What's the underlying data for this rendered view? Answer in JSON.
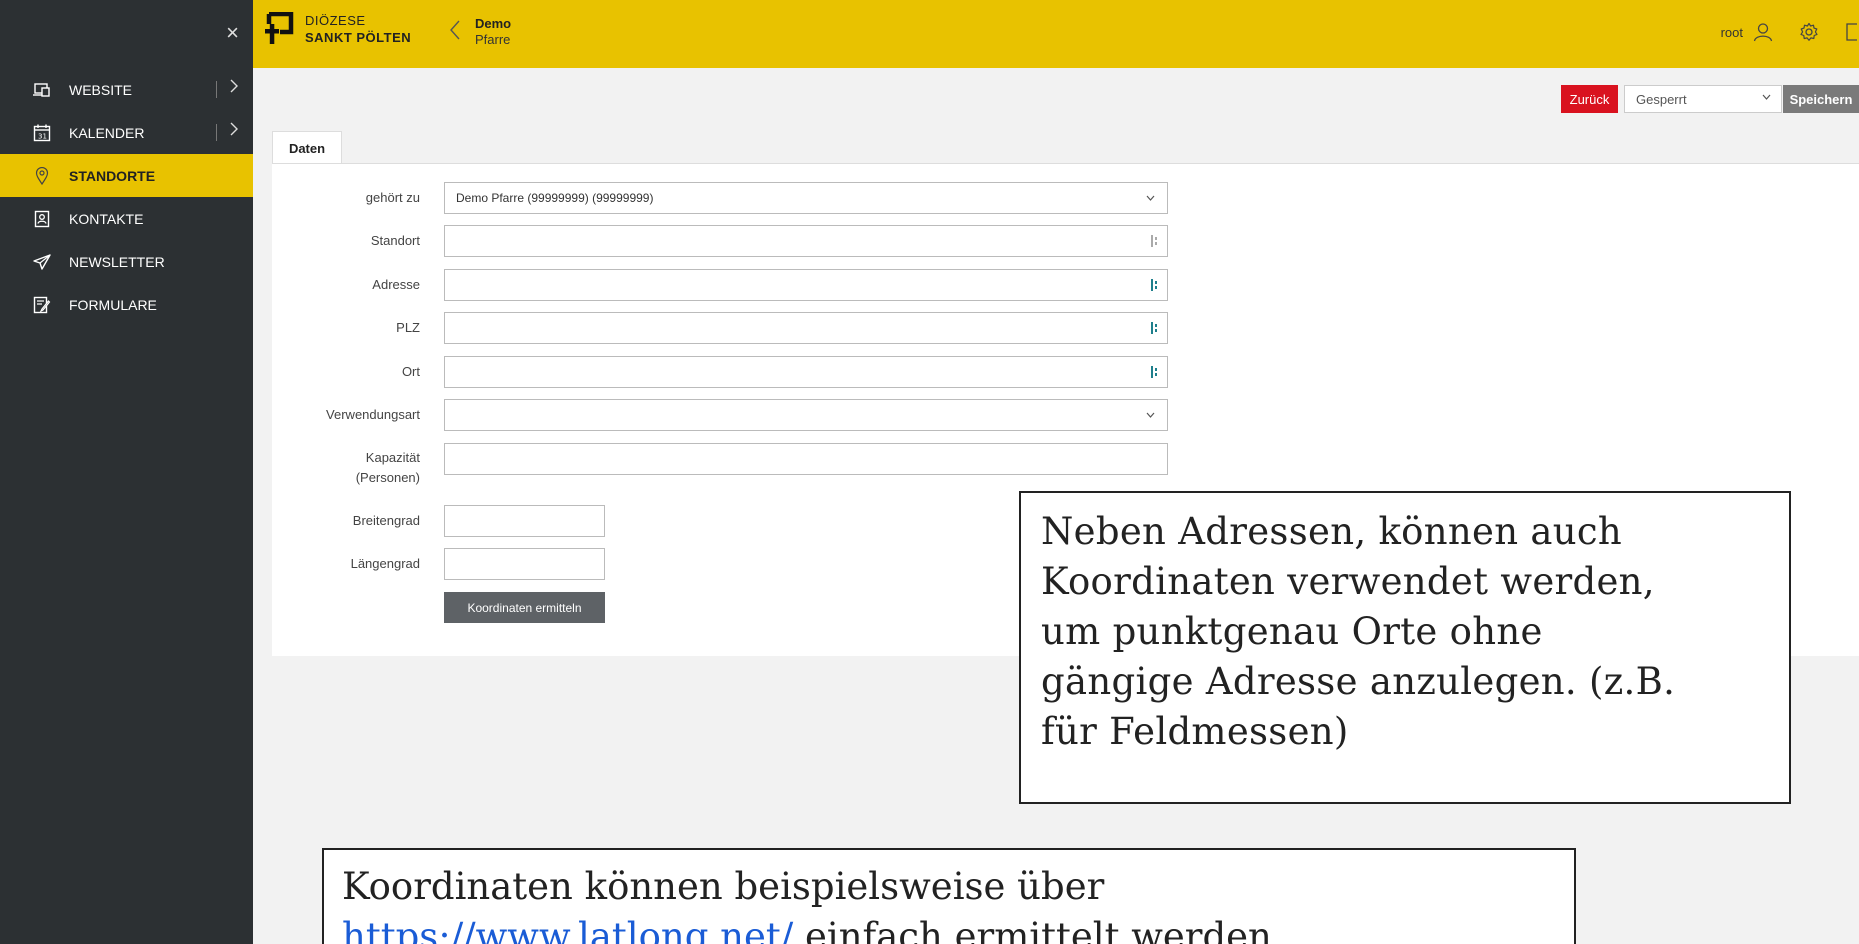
{
  "sidebar": {
    "close_glyph": "×",
    "items": [
      {
        "label": "WEBSITE",
        "icon": "laptop-icon",
        "has_submenu": true
      },
      {
        "label": "KALENDER",
        "icon": "calendar-icon",
        "has_submenu": true
      },
      {
        "label": "STANDORTE",
        "icon": "location-pin-icon",
        "active": true
      },
      {
        "label": "KONTAKTE",
        "icon": "contact-card-icon"
      },
      {
        "label": "NEWSLETTER",
        "icon": "paper-plane-icon"
      },
      {
        "label": "FORMULARE",
        "icon": "form-edit-icon"
      }
    ]
  },
  "header": {
    "logo_line1": "DIÖZESE",
    "logo_line2": "SANKT PÖLTEN",
    "breadcrumb_title": "Demo",
    "breadcrumb_sub": "Pfarre",
    "username": "root"
  },
  "actions": {
    "back_label": "Zurück",
    "status_value": "Gesperrt",
    "save_label": "Speichern"
  },
  "tabs": [
    {
      "label": "Daten"
    }
  ],
  "form": {
    "belongs_to_label": "gehört zu",
    "belongs_to_value": "Demo Pfarre (99999999) (99999999)",
    "location_label": "Standort",
    "address_label": "Adresse",
    "zip_label": "PLZ",
    "city_label": "Ort",
    "usage_label": "Verwendungsart",
    "capacity_label": "Kapazität",
    "capacity_label_2": "(Personen)",
    "latitude_label": "Breitengrad",
    "longitude_label": "Längengrad",
    "coords_button": "Koordinaten ermitteln"
  },
  "callouts": {
    "coords_note_l1": "Neben Adressen, können auch",
    "coords_note_l2": "Koordinaten verwendet werden,",
    "coords_note_l3": "um punktgenau Orte ohne",
    "coords_note_l4": "gängige Adresse anzulegen. (z.B.",
    "coords_note_l5": "für Feldmessen)",
    "lookup_note_l1": "Koordinaten können beispielsweise über",
    "lookup_link": "https://www.latlong.net/",
    "lookup_note_l2": " einfach ermittelt werden"
  },
  "colors": {
    "brand_yellow": "#e8c200",
    "sidebar_bg": "#2c3033",
    "danger": "#d9121f",
    "save_gray": "#7a7a7a"
  }
}
